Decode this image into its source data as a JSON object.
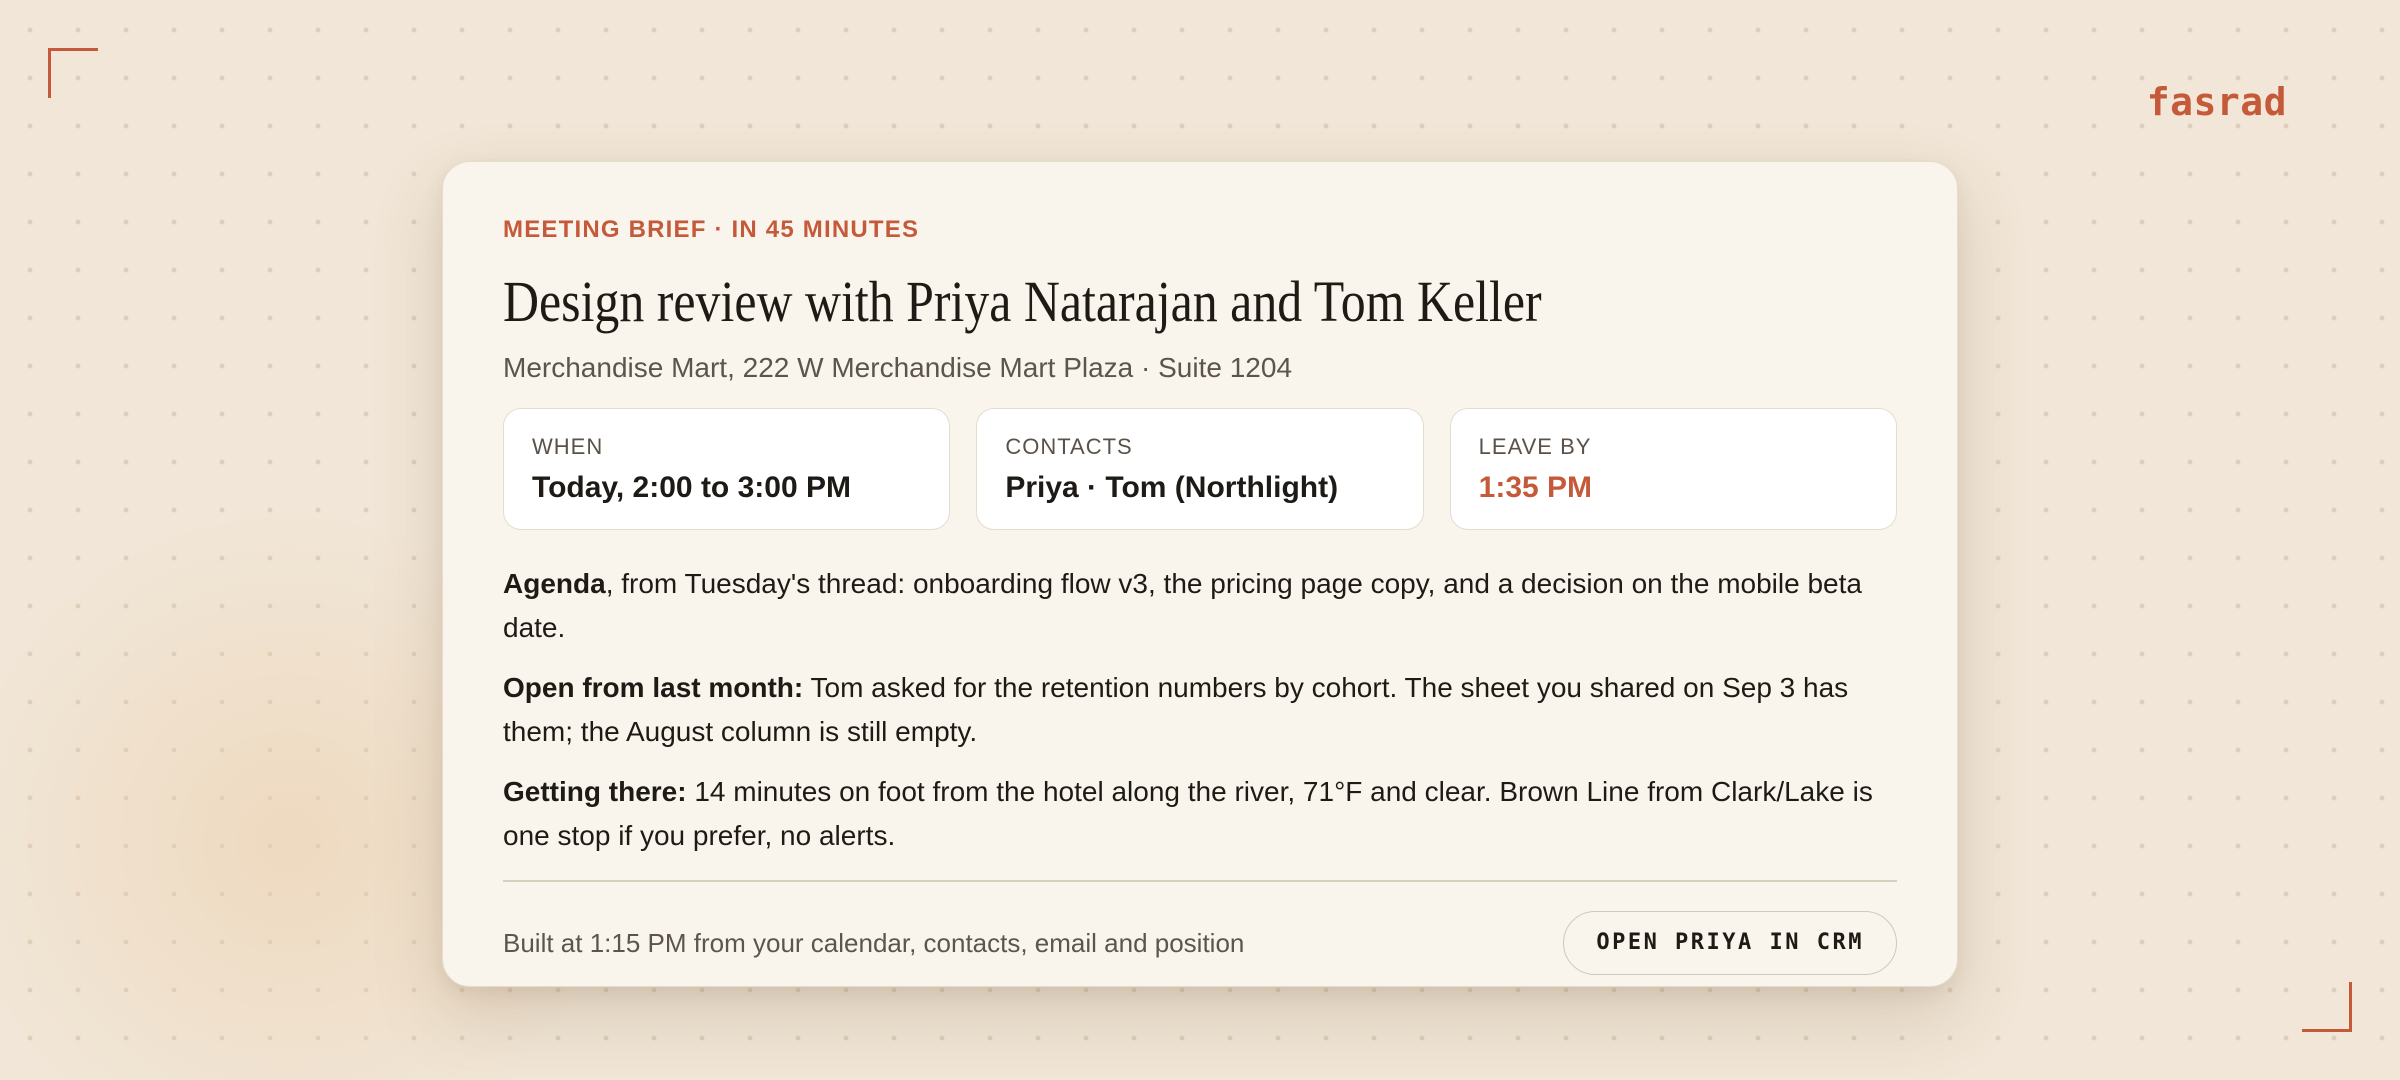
{
  "brand": {
    "logo_text": "fasrad",
    "accent_color": "#c55a3a"
  },
  "card": {
    "eyebrow": "MEETING BRIEF · IN 45 MINUTES",
    "title": "Design review with Priya Natarajan and Tom Keller",
    "address": "Merchandise Mart, 222 W Merchandise Mart Plaza · Suite 1204",
    "info": {
      "when_label": "WHEN",
      "when_value": "Today, 2:00 to 3:00 PM",
      "contacts_label": "CONTACTS",
      "contacts_value": "Priya · Tom (Northlight)",
      "leave_label": "LEAVE BY",
      "leave_value": "1:35 PM"
    },
    "sections": {
      "agenda_heading": "Agenda",
      "agenda_text": ", from Tuesday's thread: onboarding flow v3, the pricing page copy, and a decision on the mobile beta date.",
      "open_heading": "Open from last month:",
      "open_text": " Tom asked for the retention numbers by cohort. The sheet you shared on Sep 3 has them; the August column is still empty.",
      "getting_heading": "Getting there:",
      "getting_text": " 14 minutes on foot from the hotel along the river, 71°F and clear. Brown Line from Clark/Lake is one stop if you prefer, no alerts."
    },
    "footer": {
      "built_text": "Built at 1:15 PM from your calendar, contacts, email and position",
      "button_label": "OPEN PRIYA IN CRM"
    }
  }
}
